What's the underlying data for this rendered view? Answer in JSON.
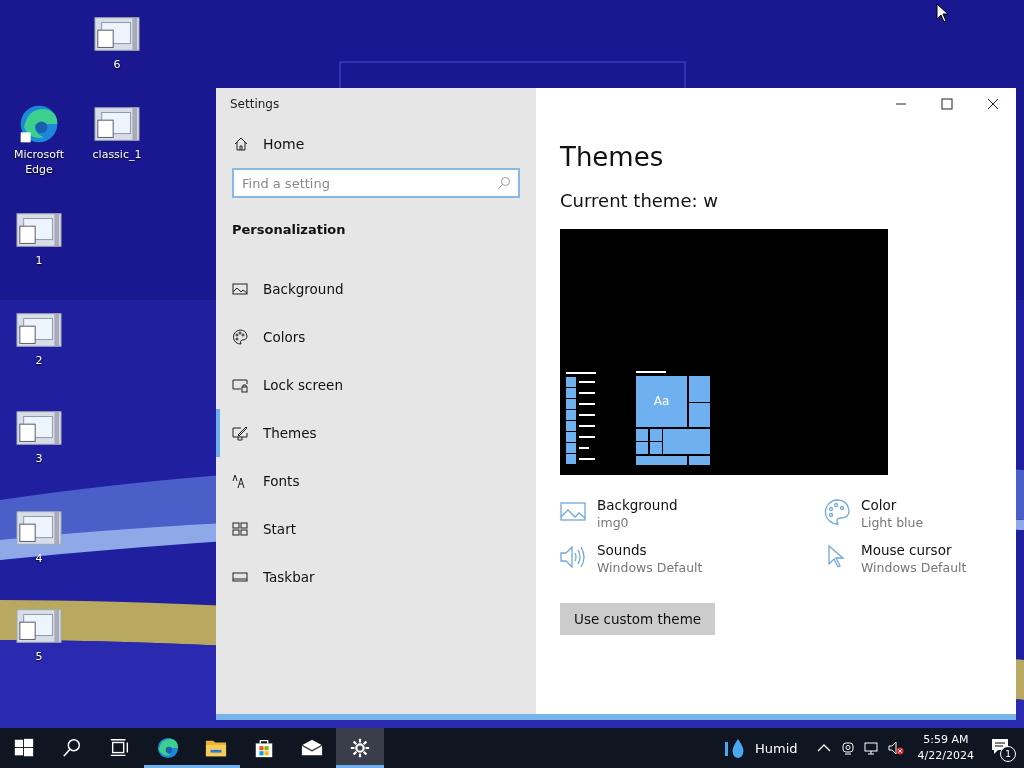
{
  "desktop_icons": [
    {
      "label": "6",
      "kind": "archive"
    },
    {
      "label": "Microsoft Edge",
      "kind": "edge"
    },
    {
      "label": "classic_1",
      "kind": "archive"
    },
    {
      "label": "1",
      "kind": "archive"
    },
    {
      "label": "2",
      "kind": "archive"
    },
    {
      "label": "3",
      "kind": "archive"
    },
    {
      "label": "4",
      "kind": "archive"
    },
    {
      "label": "5",
      "kind": "archive"
    }
  ],
  "window": {
    "title": "Settings",
    "sidebar": {
      "home": "Home",
      "search": {
        "placeholder": "Find a setting"
      },
      "section": "Personalization",
      "items": [
        {
          "label": "Background",
          "kind": "background",
          "selected": false
        },
        {
          "label": "Colors",
          "kind": "colors",
          "selected": false
        },
        {
          "label": "Lock screen",
          "kind": "lock",
          "selected": false
        },
        {
          "label": "Themes",
          "kind": "themes",
          "selected": true
        },
        {
          "label": "Fonts",
          "kind": "fonts",
          "selected": false
        },
        {
          "label": "Start",
          "kind": "start",
          "selected": false
        },
        {
          "label": "Taskbar",
          "kind": "taskbar",
          "selected": false
        }
      ]
    },
    "content": {
      "heading": "Themes",
      "current_theme": "Current theme: w",
      "preview_tile": "Aa",
      "properties": [
        {
          "label": "Background",
          "value": "img0",
          "kind": "background"
        },
        {
          "label": "Color",
          "value": "Light blue",
          "kind": "color"
        },
        {
          "label": "Sounds",
          "value": "Windows Default",
          "kind": "sounds"
        },
        {
          "label": "Mouse cursor",
          "value": "Windows Default",
          "kind": "cursor"
        }
      ],
      "button": "Use custom theme"
    }
  },
  "taskbar": {
    "apps": [
      {
        "kind": "start",
        "running": false,
        "selected": false
      },
      {
        "kind": "search",
        "running": false,
        "selected": false
      },
      {
        "kind": "taskview",
        "running": false,
        "selected": false
      },
      {
        "kind": "edge",
        "running": true,
        "selected": false
      },
      {
        "kind": "explorer",
        "running": true,
        "selected": false
      },
      {
        "kind": "store",
        "running": false,
        "selected": false
      },
      {
        "kind": "mail",
        "running": false,
        "selected": false
      },
      {
        "kind": "settings",
        "running": true,
        "selected": true
      }
    ],
    "weather": "Humid",
    "time": "5:59 AM",
    "date": "4/22/2024",
    "notifications": "1"
  }
}
